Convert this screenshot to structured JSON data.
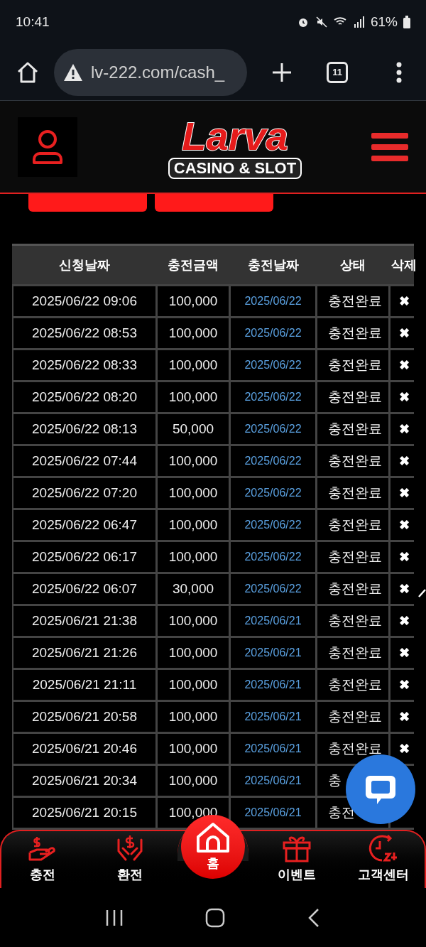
{
  "status_bar": {
    "time": "10:41",
    "battery": "61%"
  },
  "browser": {
    "url": "lv-222.com/cash_",
    "tab_count": "11"
  },
  "header": {
    "logo_title": "Larva",
    "logo_subtitle": "CASINO & SLOT"
  },
  "table": {
    "columns": [
      "신청날짜",
      "충전금액",
      "충전날짜",
      "상태",
      "삭제"
    ],
    "rows": [
      {
        "requested": "2025/06/22 09:06",
        "amount": "100,000",
        "charged": "2025/06/22",
        "status": "충전완료",
        "delete": "✖"
      },
      {
        "requested": "2025/06/22 08:53",
        "amount": "100,000",
        "charged": "2025/06/22",
        "status": "충전완료",
        "delete": "✖"
      },
      {
        "requested": "2025/06/22 08:33",
        "amount": "100,000",
        "charged": "2025/06/22",
        "status": "충전완료",
        "delete": "✖"
      },
      {
        "requested": "2025/06/22 08:20",
        "amount": "100,000",
        "charged": "2025/06/22",
        "status": "충전완료",
        "delete": "✖"
      },
      {
        "requested": "2025/06/22 08:13",
        "amount": "50,000",
        "charged": "2025/06/22",
        "status": "충전완료",
        "delete": "✖"
      },
      {
        "requested": "2025/06/22 07:44",
        "amount": "100,000",
        "charged": "2025/06/22",
        "status": "충전완료",
        "delete": "✖"
      },
      {
        "requested": "2025/06/22 07:20",
        "amount": "100,000",
        "charged": "2025/06/22",
        "status": "충전완료",
        "delete": "✖"
      },
      {
        "requested": "2025/06/22 06:47",
        "amount": "100,000",
        "charged": "2025/06/22",
        "status": "충전완료",
        "delete": "✖"
      },
      {
        "requested": "2025/06/22 06:17",
        "amount": "100,000",
        "charged": "2025/06/22",
        "status": "충전완료",
        "delete": "✖"
      },
      {
        "requested": "2025/06/22 06:07",
        "amount": "30,000",
        "charged": "2025/06/22",
        "status": "충전완료",
        "delete": "✖"
      },
      {
        "requested": "2025/06/21 21:38",
        "amount": "100,000",
        "charged": "2025/06/21",
        "status": "충전완료",
        "delete": "✖"
      },
      {
        "requested": "2025/06/21 21:26",
        "amount": "100,000",
        "charged": "2025/06/21",
        "status": "충전완료",
        "delete": "✖"
      },
      {
        "requested": "2025/06/21 21:11",
        "amount": "100,000",
        "charged": "2025/06/21",
        "status": "충전완료",
        "delete": "✖"
      },
      {
        "requested": "2025/06/21 20:58",
        "amount": "100,000",
        "charged": "2025/06/21",
        "status": "충전완료",
        "delete": "✖"
      },
      {
        "requested": "2025/06/21 20:46",
        "amount": "100,000",
        "charged": "2025/06/21",
        "status": "충전완료",
        "delete": "✖"
      },
      {
        "requested": "2025/06/21 20:34",
        "amount": "100,000",
        "charged": "2025/06/21",
        "status": "충"
      },
      {
        "requested": "2025/06/21 20:15",
        "amount": "100,000",
        "charged": "2025/06/21",
        "status": "충전"
      }
    ]
  },
  "bottom_nav": [
    {
      "kind": "deposit",
      "label": "충전",
      "selected": false
    },
    {
      "kind": "exchange",
      "label": "환전",
      "selected": false
    },
    {
      "kind": "home",
      "label": "홈",
      "selected": true
    },
    {
      "kind": "event",
      "label": "이벤트",
      "selected": false
    },
    {
      "kind": "support",
      "label": "고객센터",
      "selected": false
    }
  ]
}
